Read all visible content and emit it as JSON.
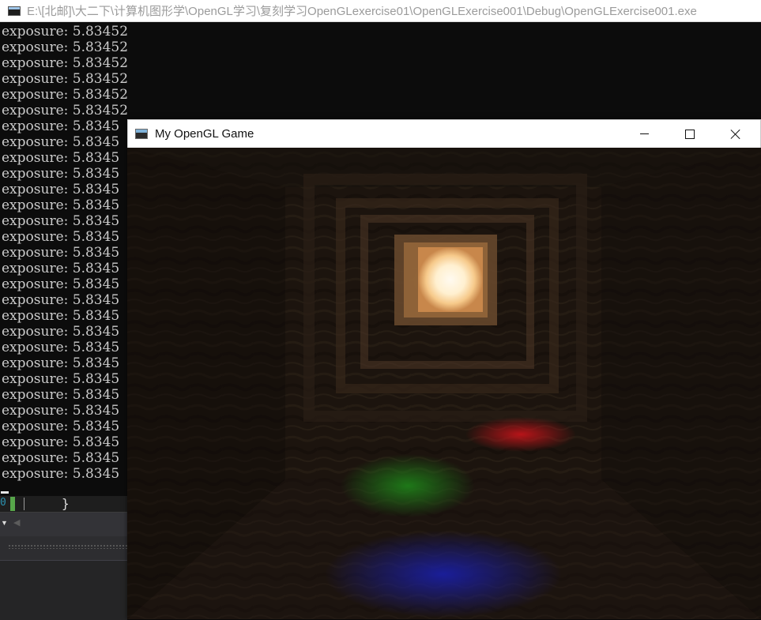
{
  "console": {
    "title": "E:\\[北邮]\\大二下\\计算机图形学\\OpenGL学习\\复刻学习OpenGLexercise01\\OpenGLExercise001\\Debug\\OpenGLExercise001.exe",
    "lines": [
      "exposure: 5.83452",
      "exposure: 5.83452",
      "exposure: 5.83452",
      "exposure: 5.83452",
      "exposure: 5.83452",
      "exposure: 5.83452",
      "exposure: 5.8345",
      "exposure: 5.8345",
      "exposure: 5.8345",
      "exposure: 5.8345",
      "exposure: 5.8345",
      "exposure: 5.8345",
      "exposure: 5.8345",
      "exposure: 5.8345",
      "exposure: 5.8345",
      "exposure: 5.8345",
      "exposure: 5.8345",
      "exposure: 5.8345",
      "exposure: 5.8345",
      "exposure: 5.8345",
      "exposure: 5.8345",
      "exposure: 5.8345",
      "exposure: 5.8345",
      "exposure: 5.8345",
      "exposure: 5.8345",
      "exposure: 5.8345",
      "exposure: 5.8345",
      "exposure: 5.8345",
      "exposure: 5.8345"
    ]
  },
  "ide": {
    "line_number": "0",
    "code": "}",
    "dropdown_icon": "triangle-down",
    "scroll_icon": "triangle-left"
  },
  "game_window": {
    "title": "My OpenGL Game",
    "controls": [
      "minimize",
      "maximize",
      "close"
    ]
  },
  "scene": {
    "colors": {
      "light": "#fff4dc",
      "wood": "#3a2a1c",
      "red_light": "#c8141a",
      "green_light": "#1f8a1a",
      "blue_light": "#1a1fa8"
    }
  }
}
